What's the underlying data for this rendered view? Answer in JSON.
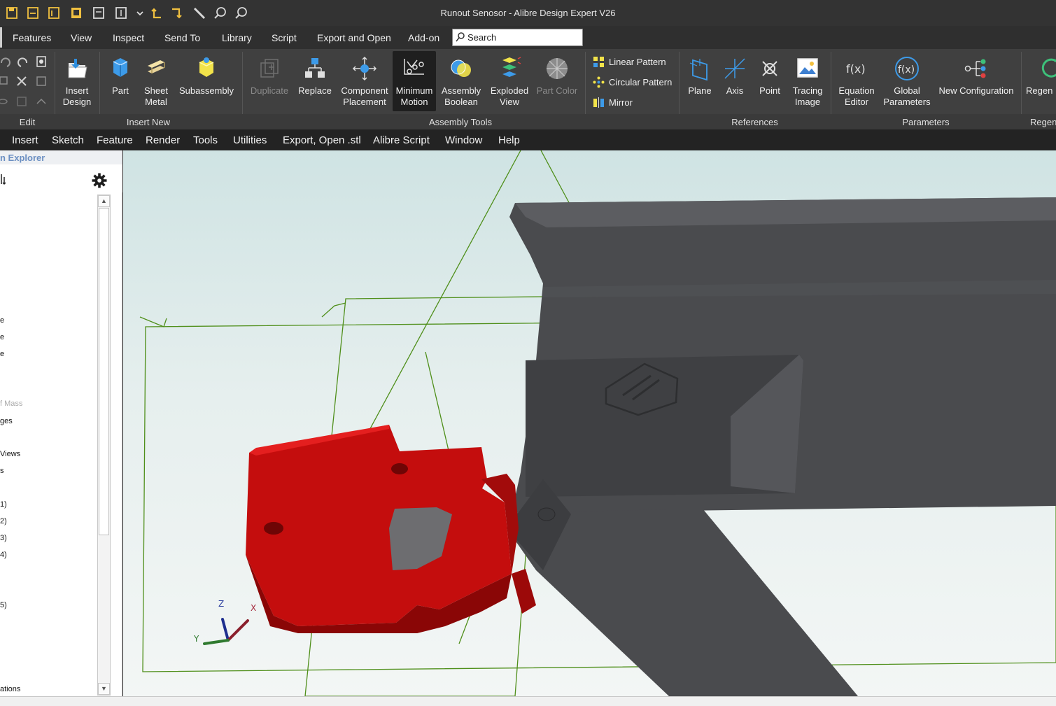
{
  "window": {
    "title": "Runout Senosor - Alibre Design Expert V26"
  },
  "menu_tabs": [
    "Features",
    "View",
    "Inspect",
    "Send To",
    "Library",
    "Script",
    "Export and Open",
    "Add-on"
  ],
  "search": {
    "placeholder": "Search"
  },
  "ribbon": {
    "insert_design": "Insert Design",
    "part": "Part",
    "sheet_metal": "Sheet Metal",
    "subassembly": "Subassembly",
    "duplicate": "Duplicate",
    "replace": "Replace",
    "component_placement": "Component Placement",
    "minimum_motion": "Minimum Motion",
    "assembly_boolean": "Assembly Boolean",
    "exploded_view": "Exploded View",
    "part_color": "Part Color",
    "linear_pattern": "Linear Pattern",
    "circular_pattern": "Circular Pattern",
    "mirror": "Mirror",
    "plane": "Plane",
    "axis": "Axis",
    "point": "Point",
    "tracing_image": "Tracing Image",
    "equation_editor": "Equation Editor",
    "global_parameters": "Global Parameters",
    "new_configuration": "New Configuration",
    "regen": "Regen"
  },
  "ribbon_groups": {
    "edit": "Edit",
    "insert_new": "Insert New",
    "assembly_tools": "Assembly Tools",
    "references": "References",
    "parameters": "Parameters",
    "regen": "Regen"
  },
  "classic_menu": [
    "Insert",
    "Sketch",
    "Feature",
    "Render",
    "Tools",
    "Utilities",
    "Export, Open .stl",
    "Alibre Script",
    "Window",
    "Help"
  ],
  "explorer": {
    "title": "n Explorer",
    "items": [
      "e",
      "e",
      "e",
      "f Mass",
      "ges",
      "Views",
      "s",
      "1)",
      "2)",
      "3)",
      "4)",
      "5)",
      "ations"
    ]
  },
  "triad": {
    "z": "Z",
    "x": "X",
    "y": "Y"
  },
  "colors": {
    "accent_part": "#c40d0d",
    "housing": "#4a4b4e",
    "sketch_lines": "#4f8f1a",
    "viewport_top": "#cfe3e3"
  }
}
